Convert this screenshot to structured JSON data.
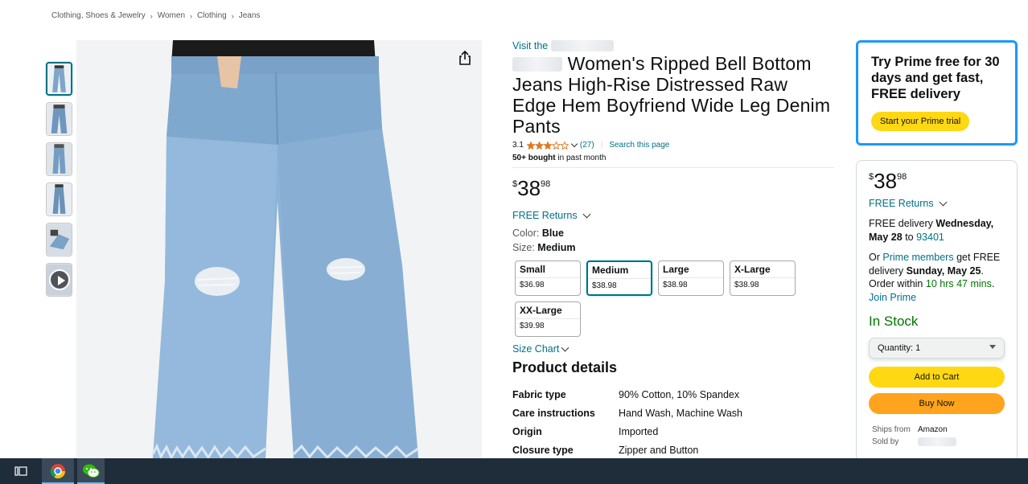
{
  "breadcrumb": [
    "Clothing, Shoes & Jewelry",
    "Women",
    "Clothing",
    "Jeans"
  ],
  "product": {
    "store_prefix": "Visit the",
    "title_suffix": "Women's Ripped Bell Bottom Jeans High-Rise Distressed Raw Edge Hem Boyfriend Wide Leg Denim Pants",
    "rating": "3.1",
    "review_count": "(27)",
    "search_page": "Search this page",
    "bought_bold": "50+ bought",
    "bought_rest": "in past month",
    "rating_fraction": 0.62
  },
  "price": {
    "symbol": "$",
    "whole": "38",
    "fraction": "98"
  },
  "returns_label": "FREE Returns",
  "color": {
    "label": "Color:",
    "value": "Blue"
  },
  "size": {
    "label": "Size:",
    "value": "Medium",
    "options": [
      {
        "name": "Small",
        "price": "$36.98",
        "selected": false
      },
      {
        "name": "Medium",
        "price": "$38.98",
        "selected": true
      },
      {
        "name": "Large",
        "price": "$38.98",
        "selected": false
      },
      {
        "name": "X-Large",
        "price": "$38.98",
        "selected": false
      },
      {
        "name": "XX-Large",
        "price": "$39.98",
        "selected": false
      }
    ],
    "chart_label": "Size Chart"
  },
  "details": {
    "title": "Product details",
    "rows": [
      {
        "k": "Fabric type",
        "v": "90% Cotton, 10% Spandex"
      },
      {
        "k": "Care instructions",
        "v": "Hand Wash, Machine Wash"
      },
      {
        "k": "Origin",
        "v": "Imported"
      },
      {
        "k": "Closure type",
        "v": "Zipper and Button"
      }
    ]
  },
  "prime_promo": {
    "text": "Try Prime free for 30 days and get fast, FREE delivery",
    "button": "Start your Prime trial"
  },
  "buybox": {
    "free_delivery": "FREE delivery",
    "delivery_date": "Wednesday, May 28",
    "to": "to",
    "zip": "93401",
    "or": "Or",
    "prime_members": "Prime members",
    "get_free": "get FREE delivery",
    "fast_date": "Sunday, May 25",
    "order_within": ". Order within",
    "countdown": "10 hrs 47 mins",
    "join_prime": "Join Prime",
    "in_stock": "In Stock",
    "quantity_label": "Quantity:",
    "quantity_value": "1",
    "add_to_cart": "Add to Cart",
    "buy_now": "Buy Now",
    "ships_from_label": "Ships from",
    "ships_from_value": "Amazon",
    "sold_by_label": "Sold by"
  },
  "colors": {
    "link": "#007185",
    "prime_border": "#1a98ff",
    "cart": "#ffd814",
    "buy": "#ffa41c",
    "stock": "#007600"
  }
}
